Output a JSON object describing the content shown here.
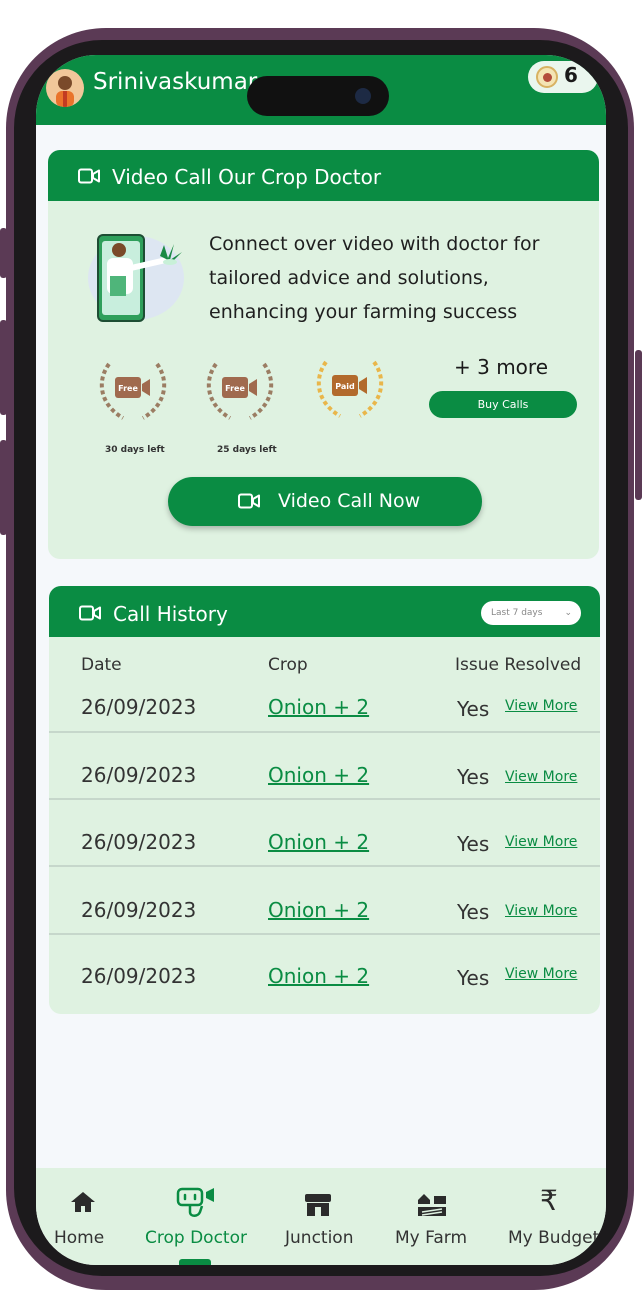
{
  "header": {
    "user_name": "Srinivaskumar",
    "coin_count": "6"
  },
  "video_card": {
    "title": "Video Call Our Crop Doctor",
    "description": "Connect over video with doctor for tailored advice and solutions, enhancing your farming success",
    "badges": [
      {
        "label": "Free",
        "days_left": "30 days left"
      },
      {
        "label": "Free",
        "days_left": "25 days left"
      },
      {
        "label": "Paid",
        "days_left": ""
      }
    ],
    "more_text": "+ 3 more",
    "buy_calls_label": "Buy Calls",
    "video_call_label": "Video Call Now"
  },
  "history": {
    "title": "Call History",
    "filter_value": "Last 7 days",
    "columns": {
      "date": "Date",
      "crop": "Crop",
      "resolved": "Issue Resolved"
    },
    "rows": [
      {
        "date": "26/09/2023",
        "crop": "Onion + 2",
        "resolved": "Yes",
        "action": "View More"
      },
      {
        "date": "26/09/2023",
        "crop": "Onion + 2",
        "resolved": "Yes",
        "action": "View More"
      },
      {
        "date": "26/09/2023",
        "crop": "Onion + 2",
        "resolved": "Yes",
        "action": "View More"
      },
      {
        "date": "26/09/2023",
        "crop": "Onion + 2",
        "resolved": "Yes",
        "action": "View More"
      },
      {
        "date": "26/09/2023",
        "crop": "Onion + 2",
        "resolved": "Yes",
        "action": "View More"
      }
    ]
  },
  "nav": {
    "items": [
      {
        "label": "Home",
        "icon": "home-icon"
      },
      {
        "label": "Crop Doctor",
        "icon": "stethoscope-icon",
        "active": true
      },
      {
        "label": "Junction",
        "icon": "store-icon"
      },
      {
        "label": "My Farm",
        "icon": "farm-icon"
      },
      {
        "label": "My Budget",
        "icon": "rupee-icon"
      }
    ]
  },
  "colors": {
    "primary": "#0a8c43",
    "card_bg": "#dff2e1",
    "page_bg": "#f5f8fb"
  }
}
